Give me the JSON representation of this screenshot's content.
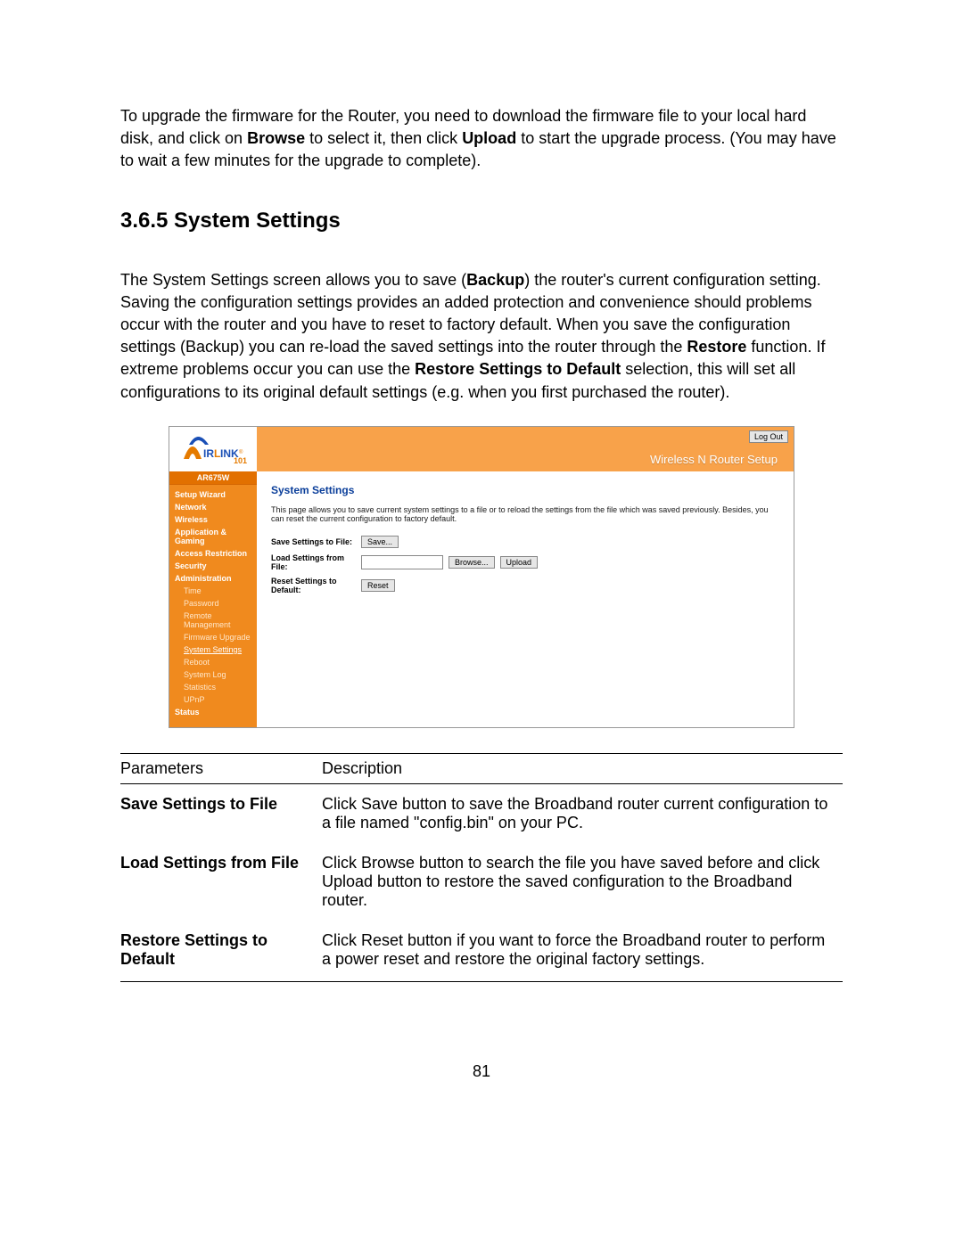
{
  "intro": {
    "pre": "To upgrade the firmware for the Router, you need to download the firmware file to your local hard disk, and click on ",
    "b1": "Browse",
    "mid1": " to select it, then click ",
    "b2": "Upload",
    "post": " to start the upgrade process. (You may have to wait a few minutes for the upgrade to complete)."
  },
  "heading": "3.6.5 System Settings",
  "section_body": {
    "p1a": "The System Settings screen allows you to save (",
    "b1": "Backup",
    "p1b": ") the router's current configuration setting. Saving the configuration settings provides an added protection and convenience should problems occur with the router and you have to reset to factory default. When you save the configuration settings (Backup) you can re-load the saved settings into the router through the ",
    "b2": "Restore",
    "p1c": " function. If extreme problems occur you can use the ",
    "b3": "Restore Settings to Default",
    "p1d": " selection, this will set all configurations to its original default settings (e.g. when you first purchased the router)."
  },
  "shot": {
    "logout": "Log Out",
    "title": "Wireless N Router Setup",
    "model": "AR675W",
    "nav": {
      "items": [
        "Setup Wizard",
        "Network",
        "Wireless",
        "Application & Gaming",
        "Access Restriction",
        "Security",
        "Administration"
      ],
      "sub": [
        "Time",
        "Password",
        "Remote Management",
        "Firmware Upgrade",
        "System Settings",
        "Reboot",
        "System Log",
        "Statistics",
        "UPnP"
      ],
      "status": "Status"
    },
    "content": {
      "heading": "System Settings",
      "desc": "This page allows you to save current system settings to a file or to reload the settings from the file which was saved previously. Besides, you can reset the current configuration to factory default.",
      "rows": {
        "save_lbl": "Save Settings to File:",
        "save_btn": "Save...",
        "load_lbl": "Load Settings from File:",
        "browse_btn": "Browse...",
        "upload_btn": "Upload",
        "reset_lbl": "Reset Settings to Default:",
        "reset_btn": "Reset"
      }
    }
  },
  "table": {
    "head": {
      "c1": "Parameters",
      "c2": "Description"
    },
    "rows": [
      {
        "name": "Save Settings to File",
        "desc": "Click Save button to save the Broadband router current configuration to a file named \"config.bin\" on your PC."
      },
      {
        "name": "Load Settings from File",
        "desc": "Click Browse button to search the file you have saved before and click Upload button to restore the saved configuration to the Broadband router."
      },
      {
        "name": "Restore Settings to Default",
        "desc": "Click Reset button if you want to force the Broadband router to perform a power reset and restore the original factory settings."
      }
    ]
  },
  "page_number": "81"
}
